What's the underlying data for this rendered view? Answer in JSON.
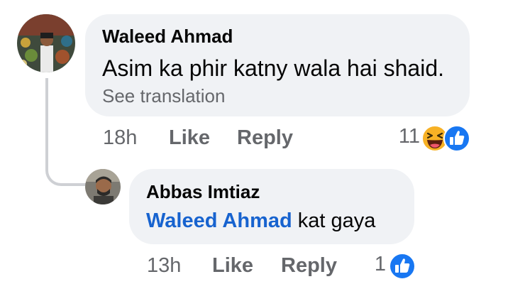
{
  "comments": [
    {
      "author": "Waleed Ahmad",
      "text": "Asim ka phir katny wala hai shaid.",
      "see_translation": "See translation",
      "time": "18h",
      "like_label": "Like",
      "reply_label": "Reply",
      "reaction_count": "11",
      "reactions": [
        "haha-icon",
        "like-icon"
      ]
    }
  ],
  "replies": [
    {
      "author": "Abbas Imtiaz",
      "mention": "Waleed Ahmad",
      "text": "kat gaya",
      "time": "13h",
      "like_label": "Like",
      "reply_label": "Reply",
      "reaction_count": "1",
      "reactions": [
        "like-icon"
      ]
    }
  ],
  "colors": {
    "bubble": "#f0f2f5",
    "mention": "#1763cf",
    "meta": "#65676b",
    "like_blue": "#1877f2",
    "haha_yellow": "#f7b125"
  }
}
